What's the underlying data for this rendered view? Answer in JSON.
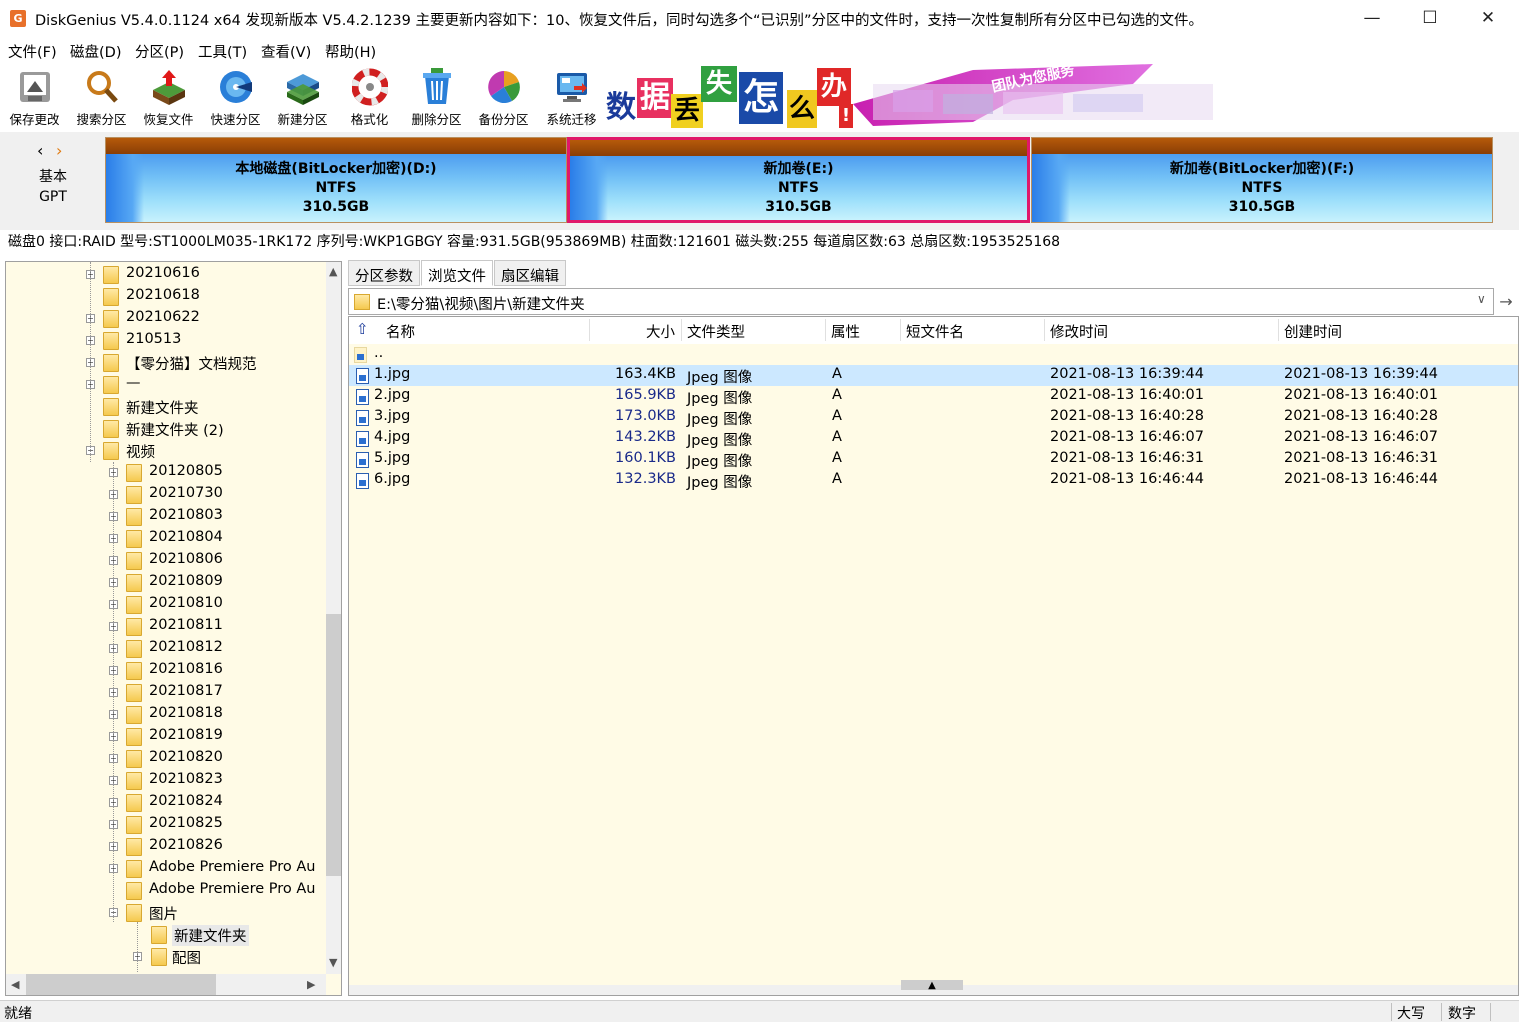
{
  "window": {
    "title": "DiskGenius V5.4.0.1124 x64   发现新版本 V5.4.2.1239 主要更新内容如下：10、恢复文件后，同时勾选多个“已识别”分区中的文件时，支持一次性复制所有分区中已勾选的文件。",
    "app_icon": "G"
  },
  "menu": [
    "文件(F)",
    "磁盘(D)",
    "分区(P)",
    "工具(T)",
    "查看(V)",
    "帮助(H)"
  ],
  "toolbar": [
    {
      "label": "保存更改",
      "icon": "save-icon"
    },
    {
      "label": "搜索分区",
      "icon": "search-icon"
    },
    {
      "label": "恢复文件",
      "icon": "recover-icon"
    },
    {
      "label": "快速分区",
      "icon": "quick-partition-icon"
    },
    {
      "label": "新建分区",
      "icon": "new-partition-icon"
    },
    {
      "label": "格式化",
      "icon": "format-icon"
    },
    {
      "label": "删除分区",
      "icon": "delete-icon"
    },
    {
      "label": "备份分区",
      "icon": "backup-icon"
    },
    {
      "label": "系统迁移",
      "icon": "migrate-icon"
    }
  ],
  "banner": {
    "chars": [
      "数",
      "据",
      "丢",
      "失",
      "怎",
      "么",
      "办"
    ],
    "suffix": "!",
    "slogan": "团队为您服务"
  },
  "disk": {
    "type_line1": "基本",
    "type_line2": "GPT",
    "partitions": [
      {
        "name": "本地磁盘(BitLocker加密)(D:)",
        "fs": "NTFS",
        "size": "310.5GB",
        "selected": false
      },
      {
        "name": "新加卷(E:)",
        "fs": "NTFS",
        "size": "310.5GB",
        "selected": true
      },
      {
        "name": "新加卷(BitLocker加密)(F:)",
        "fs": "NTFS",
        "size": "310.5GB",
        "selected": false
      }
    ],
    "info": "磁盘0 接口:RAID  型号:ST1000LM035-1RK172  序列号:WKP1GBGY  容量:931.5GB(953869MB)  柱面数:121601  磁头数:255  每道扇区数:63  总扇区数:1953525168"
  },
  "tree": {
    "items": [
      {
        "label": "20210616",
        "expander": "+",
        "level": 0
      },
      {
        "label": "20210618",
        "expander": "",
        "level": 0
      },
      {
        "label": "20210622",
        "expander": "+",
        "level": 0
      },
      {
        "label": "210513",
        "expander": "+",
        "level": 0
      },
      {
        "label": "【零分猫】文档规范",
        "expander": "+",
        "level": 0
      },
      {
        "label": "—",
        "expander": "+",
        "level": 0
      },
      {
        "label": "新建文件夹",
        "expander": "",
        "level": 0
      },
      {
        "label": "新建文件夹 (2)",
        "expander": "",
        "level": 0
      },
      {
        "label": "视频",
        "expander": "-",
        "level": 0
      },
      {
        "label": "20120805",
        "expander": "+",
        "level": 1
      },
      {
        "label": "20210730",
        "expander": "+",
        "level": 1
      },
      {
        "label": "20210803",
        "expander": "+",
        "level": 1
      },
      {
        "label": "20210804",
        "expander": "+",
        "level": 1
      },
      {
        "label": "20210806",
        "expander": "+",
        "level": 1
      },
      {
        "label": "20210809",
        "expander": "+",
        "level": 1
      },
      {
        "label": "20210810",
        "expander": "+",
        "level": 1
      },
      {
        "label": "20210811",
        "expander": "+",
        "level": 1
      },
      {
        "label": "20210812",
        "expander": "+",
        "level": 1
      },
      {
        "label": "20210816",
        "expander": "+",
        "level": 1
      },
      {
        "label": "20210817",
        "expander": "+",
        "level": 1
      },
      {
        "label": "20210818",
        "expander": "+",
        "level": 1
      },
      {
        "label": "20210819",
        "expander": "+",
        "level": 1
      },
      {
        "label": "20210820",
        "expander": "+",
        "level": 1
      },
      {
        "label": "20210823",
        "expander": "+",
        "level": 1
      },
      {
        "label": "20210824",
        "expander": "+",
        "level": 1
      },
      {
        "label": "20210825",
        "expander": "+",
        "level": 1
      },
      {
        "label": "20210826",
        "expander": "+",
        "level": 1
      },
      {
        "label": "Adobe Premiere Pro Au",
        "expander": "+",
        "level": 1
      },
      {
        "label": "Adobe Premiere Pro Au",
        "expander": "",
        "level": 1
      },
      {
        "label": "图片",
        "expander": "-",
        "level": 1
      },
      {
        "label": "新建文件夹",
        "expander": "",
        "level": 2,
        "selected": true
      },
      {
        "label": "配图",
        "expander": "+",
        "level": 2
      }
    ]
  },
  "tabs": [
    {
      "label": "分区参数",
      "active": false
    },
    {
      "label": "浏览文件",
      "active": true
    },
    {
      "label": "扇区编辑",
      "active": false
    }
  ],
  "path": "E:\\零分猫\\视频\\图片\\新建文件夹",
  "columns": [
    "名称",
    "大小",
    "文件类型",
    "属性",
    "短文件名",
    "修改时间",
    "创建时间"
  ],
  "files": [
    {
      "name": "..",
      "size": "",
      "type": "",
      "attr": "",
      "short": "",
      "modified": "",
      "created": "",
      "parent": true
    },
    {
      "name": "1.jpg",
      "size": "163.4KB",
      "type": "Jpeg 图像",
      "attr": "A",
      "short": "",
      "modified": "2021-08-13 16:39:44",
      "created": "2021-08-13 16:39:44",
      "selected": true
    },
    {
      "name": "2.jpg",
      "size": "165.9KB",
      "type": "Jpeg 图像",
      "attr": "A",
      "short": "",
      "modified": "2021-08-13 16:40:01",
      "created": "2021-08-13 16:40:01"
    },
    {
      "name": "3.jpg",
      "size": "173.0KB",
      "type": "Jpeg 图像",
      "attr": "A",
      "short": "",
      "modified": "2021-08-13 16:40:28",
      "created": "2021-08-13 16:40:28"
    },
    {
      "name": "4.jpg",
      "size": "143.2KB",
      "type": "Jpeg 图像",
      "attr": "A",
      "short": "",
      "modified": "2021-08-13 16:46:07",
      "created": "2021-08-13 16:46:07"
    },
    {
      "name": "5.jpg",
      "size": "160.1KB",
      "type": "Jpeg 图像",
      "attr": "A",
      "short": "",
      "modified": "2021-08-13 16:46:31",
      "created": "2021-08-13 16:46:31"
    },
    {
      "name": "6.jpg",
      "size": "132.3KB",
      "type": "Jpeg 图像",
      "attr": "A",
      "short": "",
      "modified": "2021-08-13 16:46:44",
      "created": "2021-08-13 16:46:44"
    }
  ],
  "status": {
    "left": "就绪",
    "caps": "大写",
    "num": "数字"
  },
  "colors": {
    "selected_partition_border": "#e0186a",
    "selected_row": "#cce8ff",
    "panel_background": "#fffbe6",
    "size_text": "#1a2a8a"
  }
}
